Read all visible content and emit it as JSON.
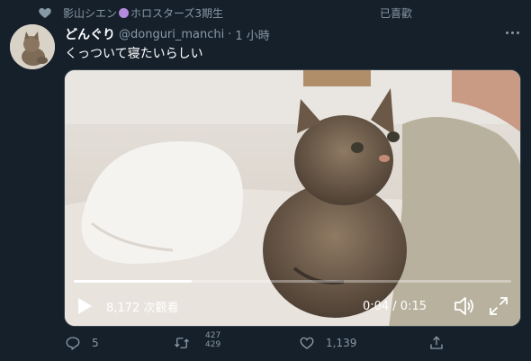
{
  "context": {
    "user_name_part1": "影山シエン",
    "user_name_part2": "ホロスターズ3期生",
    "liked_text": "已喜歡"
  },
  "tweet": {
    "display_name": "どんぐり",
    "handle": "@donguri_manchi",
    "separator": "·",
    "time": "1 小時",
    "text": "くっついて寝たいらしい"
  },
  "video": {
    "views": "8,172 次觀看",
    "timecode": "0:04 / 0:15",
    "progress": 0.27
  },
  "actions": {
    "reply_count": "5",
    "retweet_count_partial": "427\n429",
    "like_count": "1,139"
  },
  "colors": {
    "background": "#15202b",
    "secondary_text": "#8899a6",
    "primary_text": "#ffffff",
    "badge_purple": "#b38bdc"
  },
  "icons": {
    "context": "heart-icon",
    "more": "more-icon",
    "play": "play-icon",
    "volume": "volume-icon",
    "fullscreen": "fullscreen-icon",
    "reply": "reply-icon",
    "retweet": "retweet-icon",
    "like": "like-icon",
    "share": "share-icon"
  }
}
